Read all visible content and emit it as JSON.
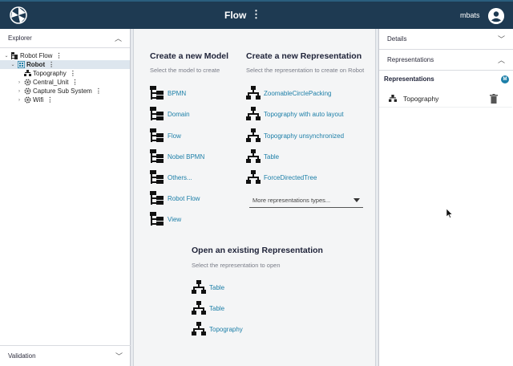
{
  "header": {
    "title": "Flow",
    "more": "⋮",
    "user": "mbats"
  },
  "explorer": {
    "title": "Explorer",
    "items": [
      {
        "label": "Robot Flow",
        "more": "⋮"
      },
      {
        "label": "Robot",
        "more": "⋮"
      },
      {
        "label": "Topography",
        "more": "⋮"
      },
      {
        "label": "Central_Unit",
        "more": "⋮"
      },
      {
        "label": "Capture Sub System",
        "more": "⋮"
      },
      {
        "label": "Wifi",
        "more": "⋮"
      }
    ]
  },
  "validation": {
    "title": "Validation"
  },
  "models": {
    "title": "Create a new Model",
    "subtitle": "Select the model to create",
    "items": [
      "BPMN",
      "Domain",
      "Flow",
      "Nobel BPMN",
      "Others...",
      "Robot Flow",
      "View"
    ]
  },
  "representations": {
    "title": "Create a new Representation",
    "subtitle": "Select the representation to create on Robot",
    "items": [
      "ZoomableCirclePacking",
      "Topography with auto layout",
      "Topography unsynchronized",
      "Table",
      "ForceDirectedTree"
    ],
    "more_placeholder": "More representations types..."
  },
  "existing": {
    "title": "Open an existing Representation",
    "subtitle": "Select the representation to open",
    "items": [
      "Table",
      "Table",
      "Topography"
    ]
  },
  "right": {
    "details": "Details",
    "representations": "Representations",
    "reps_title": "Representations",
    "badge": "M",
    "rep_item": "Topography"
  },
  "colors": {
    "topbar": "#1e3a52",
    "link": "#1c7fa8",
    "selected": "#dde6ee"
  }
}
